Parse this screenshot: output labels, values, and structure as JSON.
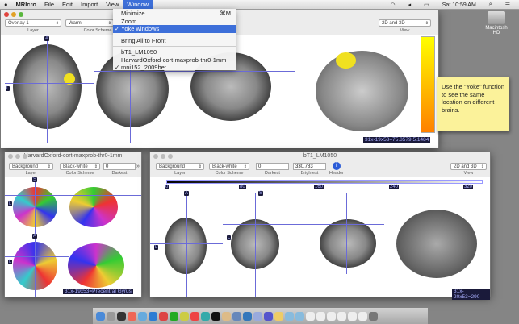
{
  "menubar": {
    "apple": "",
    "app": "MRIcro",
    "items": [
      "File",
      "Edit",
      "Import",
      "View",
      "Window"
    ],
    "clock": "Sat 10:59 AM"
  },
  "window_menu": {
    "items": [
      {
        "label": "Minimize",
        "shortcut": "⌘M"
      },
      {
        "label": "Zoom"
      },
      {
        "label": "Yoke windows",
        "checked": true,
        "highlighted": true
      },
      {
        "label": "Bring All to Front"
      },
      {
        "label": "bT1_LM1050"
      },
      {
        "label": "HarvardOxford-cort-maxprob-thr0-1mm"
      },
      {
        "label": "mni152_2009bet",
        "checked": true
      }
    ],
    "check": "✓"
  },
  "main_window": {
    "layer": "Overlay 1",
    "layer_label": "Layer",
    "scheme": "Warm",
    "scheme_label": "Color Scheme",
    "view": "2D and 3D",
    "view_label": "View",
    "tags": [
      "A",
      "L"
    ],
    "status": "31x-19x53=75.8579,5.1484",
    "colorbar": [
      "#ffff00",
      "#ff8000"
    ]
  },
  "note": {
    "text": "Use the \"Yoke\" function to see the same location on different brains."
  },
  "desktop": {
    "drive": "Macintosh HD"
  },
  "atlas_window": {
    "title": "HarvardOxford-cort-maxprob-thr0-1mm",
    "layer": "Background",
    "layer_label": "Layer",
    "scheme": "Black-white",
    "scheme_label": "Color Scheme",
    "darkest": "0",
    "darkest_label": "Darkest",
    "more": "»",
    "tags": [
      "S",
      "L",
      "A",
      "L"
    ],
    "status": "31x-19x53=Precentral Gyrus"
  },
  "t1_window": {
    "title": "bT1_LM1050",
    "layer": "Background",
    "layer_label": "Layer",
    "scheme": "Black-white",
    "scheme_label": "Color Scheme",
    "darkest": "0",
    "darkest_label": "Darkest",
    "brightest": "330.783",
    "brightest_label": "Brightest",
    "header_icon": "i",
    "header_label": "Header",
    "view": "2D and 3D",
    "view_label": "View",
    "ticks": [
      "0",
      "80",
      "160",
      "240",
      "320"
    ],
    "tags": [
      "A",
      "S",
      "L",
      "L"
    ],
    "status": "31x-20x53=290"
  }
}
